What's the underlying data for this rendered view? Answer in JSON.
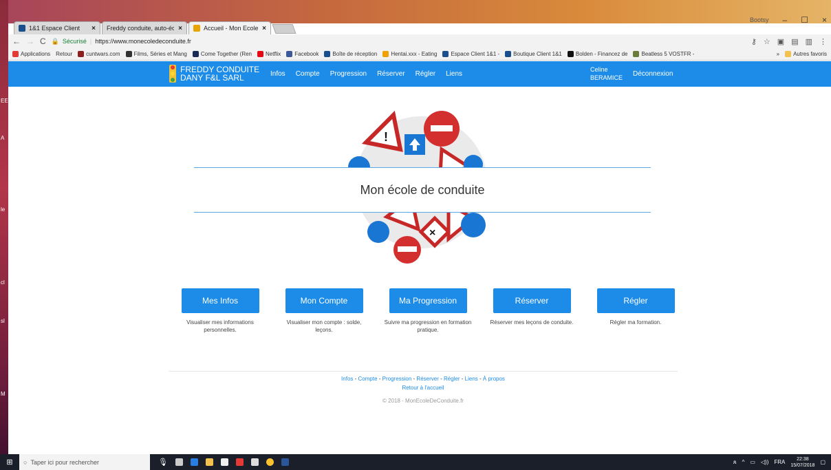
{
  "desktop": {
    "edge_labels": [
      "EE",
      "A",
      "le",
      "cl",
      "sl",
      "M"
    ]
  },
  "window": {
    "user": "Bootsy",
    "tabs": [
      {
        "label": "1&1 Espace Client",
        "close": "×",
        "color": "#1a4f8e"
      },
      {
        "label": "Freddy conduite, auto-éc",
        "close": "×",
        "color": "#dddddd"
      },
      {
        "label": "Accueil - Mon Ecole de C",
        "close": "×",
        "color": "#e8a400"
      }
    ],
    "controls": {
      "minimize": "–",
      "maximize": "☐",
      "close": "×"
    }
  },
  "browser": {
    "secure_label": "Sécurisé",
    "url": "https://www.monecoledeconduite.fr",
    "bookmarks": [
      {
        "label": "Applications",
        "color": "#e53935"
      },
      {
        "label": "Retour",
        "color": "transparent"
      },
      {
        "label": "cuntwars.com",
        "color": "#8e1f1f"
      },
      {
        "label": "Films, Séries et Mang",
        "color": "#333333"
      },
      {
        "label": "Come Together (Ren",
        "color": "#1a2a55"
      },
      {
        "label": "Netflix",
        "color": "#e50914"
      },
      {
        "label": "Facebook",
        "color": "#3b5998"
      },
      {
        "label": "Boîte de réception",
        "color": "#1a4f8e"
      },
      {
        "label": "Hentai.xxx - Eating",
        "color": "#f0a000"
      },
      {
        "label": "Espace Client 1&1 -",
        "color": "#1a4f8e"
      },
      {
        "label": "Boutique Client 1&1",
        "color": "#1a4f8e"
      },
      {
        "label": "Bolden - Financez de",
        "color": "#111111"
      },
      {
        "label": "Beatless 5 VOSTFR -",
        "color": "#6b7c3a"
      }
    ],
    "more": "»",
    "other_bookmarks": "Autres favoris"
  },
  "site": {
    "brand_line1": "FREDDY CONDUITE",
    "brand_line2": "DANY F&L SARL",
    "nav": [
      "Infos",
      "Compte",
      "Progression",
      "Réserver",
      "Régler",
      "Liens"
    ],
    "user_first": "Celine",
    "user_last": "BERAMICE",
    "logout": "Déconnexion",
    "hero_title": "Mon école de conduite",
    "cards": [
      {
        "button": "Mes Infos",
        "desc": "Visualiser mes informations personnelles."
      },
      {
        "button": "Mon Compte",
        "desc": "Visualiser mon compte : solde, leçons."
      },
      {
        "button": "Ma Progression",
        "desc": "Suivre ma progression en formation pratique."
      },
      {
        "button": "Réserver",
        "desc": "Réserver mes leçons de conduite."
      },
      {
        "button": "Régler",
        "desc": "Régler ma formation."
      }
    ],
    "footer_links": [
      "Infos",
      "Compte",
      "Progression",
      "Réserver",
      "Régler",
      "Liens",
      "À propos"
    ],
    "footer_home": "Retour à l'accueil",
    "copyright": "© 2018 - MonEcoleDeConduite.fr"
  },
  "taskbar": {
    "search_placeholder": "Taper ici pour rechercher",
    "lang": "FRA",
    "time": "22:38",
    "date": "15/07/2018"
  }
}
